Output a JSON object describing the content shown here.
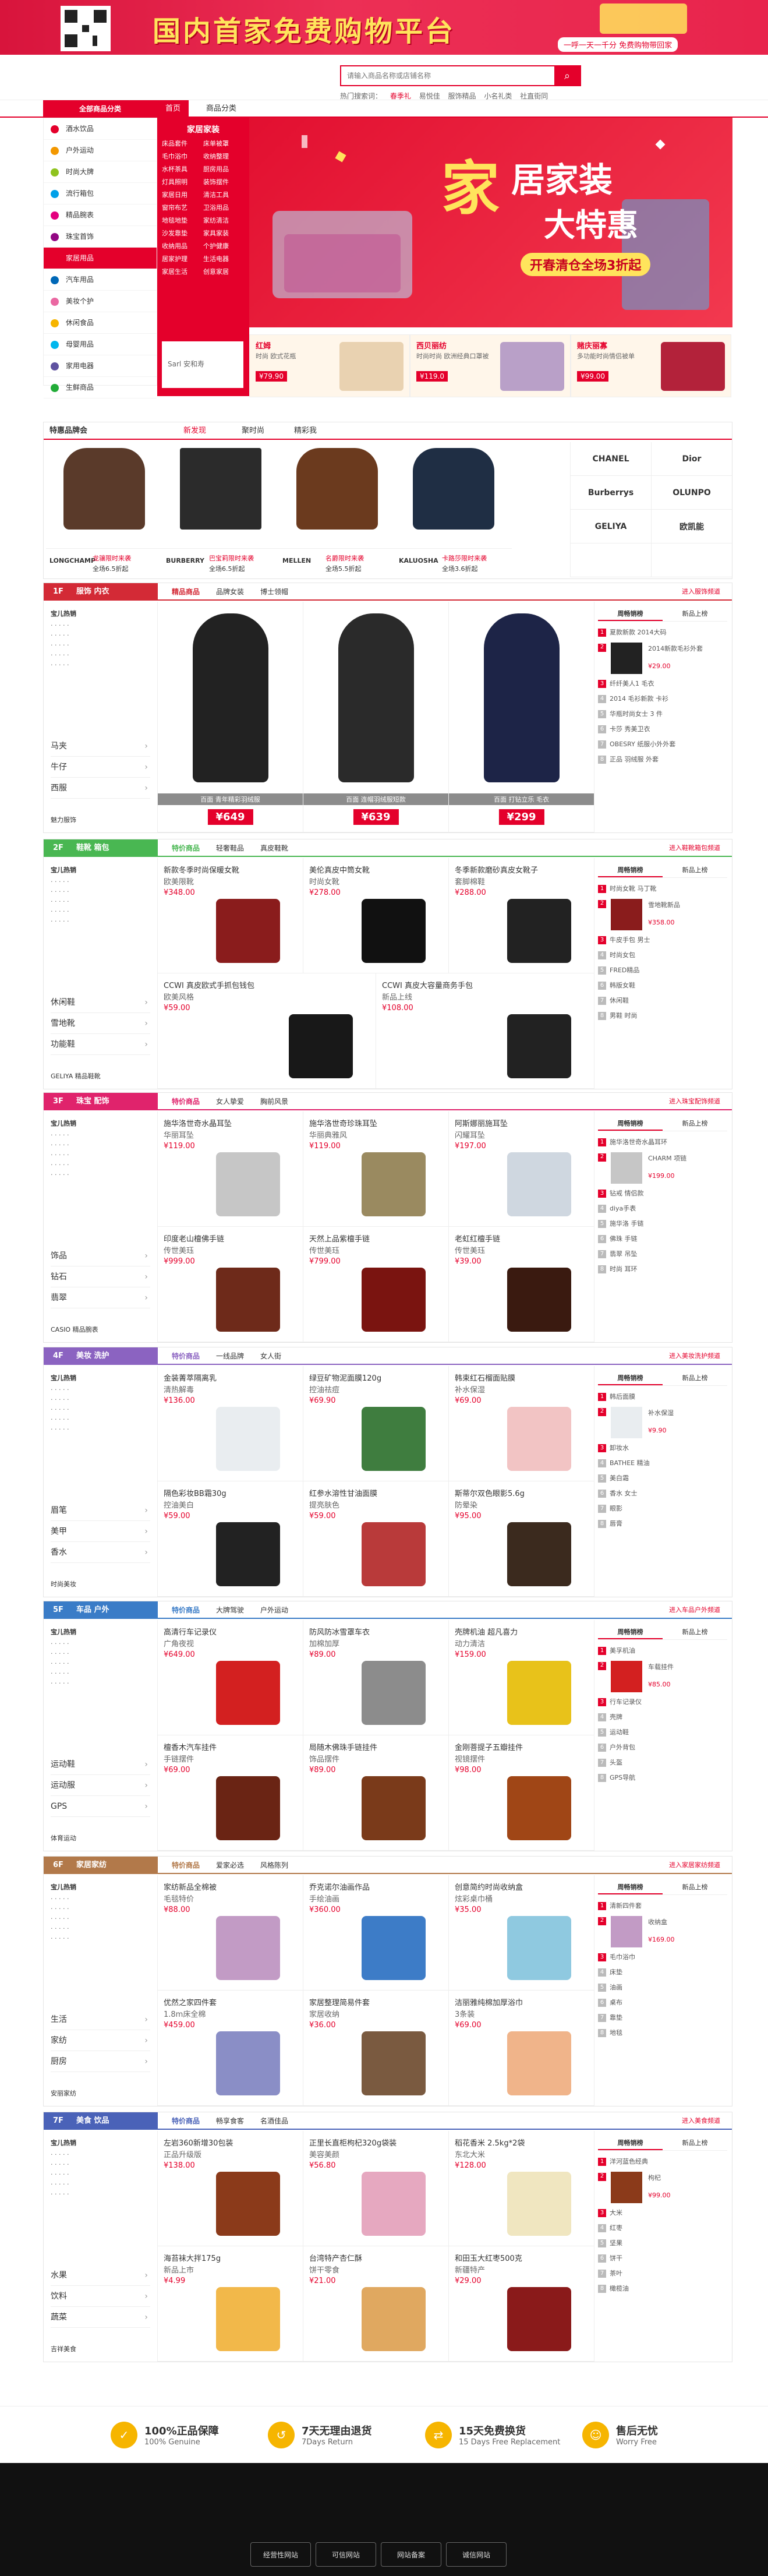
{
  "top": {
    "slogan": "国内首家免费购物平台",
    "sub": "一呼一天一千分 免费购物带回家"
  },
  "search": {
    "placeholder": "请输入商品名称或店铺名称",
    "hot_label": "热门搜索词：",
    "hot": [
      "春季礼",
      "易悦佳",
      "服饰精品",
      "小名礼类",
      "社直街同"
    ]
  },
  "nav": {
    "category": "全部商品分类",
    "tabs": [
      "首页",
      "商品分类"
    ]
  },
  "sidecat": [
    "酒水饮品",
    "户外运动",
    "时尚大牌",
    "流行箱包",
    "精品腕表",
    "珠宝首饰",
    "家居用品",
    "汽车用品",
    "美妆个护",
    "休闲食品",
    "母婴用品",
    "家用电器",
    "生鲜商品"
  ],
  "submenu": {
    "title": "家居家装",
    "items": [
      "床品套件",
      "床单被罩",
      "毛巾浴巾",
      "收纳整理",
      "水杯茶具",
      "厨房用品",
      "灯具照明",
      "装饰摆件",
      "家居日用",
      "清洁工具",
      "窗帘布艺",
      "卫浴用品",
      "地毯地垫",
      "家纺清洁",
      "沙发靠垫",
      "家具家装",
      "收纳用品",
      "个护健康",
      "居家护理",
      "生活电器",
      "家居生活",
      "创意家居"
    ],
    "brand": "Sarl 安和寿"
  },
  "banner": {
    "l1": "家",
    "l2": "居家装",
    "l3": "大特惠",
    "tag": "开春清仓全场3折起"
  },
  "promos": [
    {
      "name": "红姆",
      "desc": "时尚 欧式花瓶",
      "price": "¥79.90"
    },
    {
      "name": "西贝丽纺",
      "desc": "时尚时尚 欧洲经典口罩被",
      "price": "¥119.0"
    },
    {
      "name": "赌庆丽寡",
      "desc": "多功能时尚情侣被单",
      "price": "¥99.00"
    }
  ],
  "brandsec": {
    "tabs": [
      "特惠品牌会",
      "新发现",
      "聚时尚",
      "精彩我"
    ],
    "cards": [
      {
        "logo": "LONGCHAMP",
        "a": "龙骧限时来袭",
        "b": "全场6.5折起"
      },
      {
        "logo": "BURBERRY",
        "a": "巴宝莉限时来袭",
        "b": "全场6.5折起"
      },
      {
        "logo": "MELLEN",
        "a": "名爵限时来袭",
        "b": "全场5.5折起"
      },
      {
        "logo": "KALUOSHA",
        "a": "卡路莎限时来袭",
        "b": "全场3.6折起"
      }
    ],
    "logos": [
      "CHANEL",
      "Dior",
      "Burberrys",
      "OLUNPO",
      "GELIYA",
      "欧凯能"
    ]
  },
  "floors": [
    {
      "no": "1F",
      "name": "服饰 内衣",
      "color": "#d32a36",
      "tabs": [
        "精品商品",
        "品牌女装",
        "博士领帽"
      ],
      "more": "进入服饰频道",
      "hot": "宝儿热销",
      "links": [
        "马夹",
        "牛仔",
        "西服"
      ],
      "logo": "魅力服饰",
      "goods": [
        {
          "caption": "百面 青年精彩羽绒服",
          "price": "¥649"
        },
        {
          "caption": "百面 连帽羽绒服短款",
          "price": "¥639"
        },
        {
          "caption": "百面 打钻立乐 毛衣",
          "price": "¥299"
        }
      ],
      "rank": [
        "夏款新款 2014大码",
        "2014新款毛衫外套",
        "纤纤美人1 毛衣",
        "2014 毛衫新款 卡衫",
        "华瓶时尚女士 3 件",
        "卡莎 秀美卫衣",
        "OBESRY 纸服小外外套",
        "正品 羽绒服 外套"
      ],
      "rankprice": "¥29.00"
    },
    {
      "no": "2F",
      "name": "鞋靴 箱包",
      "color": "#49b752",
      "tabs": [
        "特价商品",
        "轻奢鞋品",
        "真皮鞋靴"
      ],
      "more": "进入鞋靴箱包频道",
      "hot": "宝儿热销",
      "links": [
        "休闲鞋",
        "雪地靴",
        "功能鞋"
      ],
      "logo": "GELIYA 精品鞋靴",
      "goods": [
        {
          "t1": "新款冬季时尚保暖女靴",
          "t2": "欧美限靴",
          "pr": "¥348.00"
        },
        {
          "t1": "美伦真皮中筒女靴",
          "t2": "时尚女靴",
          "pr": "¥278.00"
        },
        {
          "t1": "冬季新款磨砂真皮女靴子",
          "t2": "套脚棉鞋",
          "pr": "¥288.00"
        },
        {
          "t1": "CCWI 真皮欧式手抓包钱包",
          "t2": "欧美风格",
          "pr": "¥59.00"
        },
        {
          "t1": "CCWI 真皮大容量商务手包",
          "t2": "新品上线",
          "pr": "¥108.00"
        }
      ],
      "rank": [
        "时尚女靴 马丁靴",
        "雪地靴新品",
        "牛皮手包 男士",
        "时尚女包",
        "FRED精品",
        "韩版女鞋",
        "休闲鞋",
        "男鞋 时尚"
      ],
      "rankprice": "¥358.00"
    },
    {
      "no": "3F",
      "name": "珠宝 配饰",
      "color": "#e0236c",
      "tabs": [
        "特价商品",
        "女人挚爱",
        "胸前风景"
      ],
      "more": "进入珠宝配饰频道",
      "hot": "宝儿热销",
      "links": [
        "饰品",
        "钻石",
        "翡翠"
      ],
      "logo": "CASIO 精品腕表",
      "goods": [
        {
          "t1": "施华洛世奇水晶耳坠",
          "t2": "华丽耳坠",
          "pr": "¥119.00"
        },
        {
          "t1": "施华洛世奇珍珠耳坠",
          "t2": "华丽典雅风",
          "pr": "¥119.00"
        },
        {
          "t1": "阿斯娜丽施耳坠",
          "t2": "闪耀耳坠",
          "pr": "¥197.00"
        },
        {
          "t1": "印度老山檀佛手链",
          "t2": "传世美珏",
          "pr": "¥999.00"
        },
        {
          "t1": "天然上品紫檀手链",
          "t2": "传世美珏",
          "pr": "¥799.00"
        },
        {
          "t1": "老虹红檀手链",
          "t2": "传世美珏",
          "pr": "¥39.00"
        }
      ],
      "rank": [
        "施华洛世奇水晶耳环",
        "CHARM 项链",
        "钻戒 情侣款",
        "diya手表",
        "施华洛 手链",
        "佛珠 手链",
        "翡翠 吊坠",
        "时尚 耳环"
      ],
      "rankprice": "¥199.00"
    },
    {
      "no": "4F",
      "name": "美妆 洗护",
      "color": "#8b63c1",
      "tabs": [
        "特价商品",
        "一线品牌",
        "女人街"
      ],
      "more": "进入美妆洗护频道",
      "hot": "宝儿热销",
      "links": [
        "眉笔",
        "美甲",
        "香水"
      ],
      "logo": "时尚美妆",
      "goods": [
        {
          "t1": "金装菁萃隔离乳",
          "t2": "清热解毒",
          "pr": "¥136.00"
        },
        {
          "t1": "绿豆矿物泥面膜120g",
          "t2": "控油祛痘",
          "pr": "¥69.90"
        },
        {
          "t1": "韩束红石榴面贴膜",
          "t2": "补水保湿",
          "pr": "¥69.00"
        },
        {
          "t1": "隔色彩妆BB霜30g",
          "t2": "控油美白",
          "pr": "¥59.00"
        },
        {
          "t1": "红参水溶性甘油面膜",
          "t2": "提亮肤色",
          "pr": "¥59.00"
        },
        {
          "t1": "斯蒂尔双色眼影5.6g",
          "t2": "防晕染",
          "pr": "¥95.00"
        }
      ],
      "rank": [
        "韩后面膜",
        "补水保湿",
        "卸妆水",
        "BATHEE 精油",
        "美白霜",
        "香水 女士",
        "眼影",
        "唇膏"
      ],
      "rankprice": "¥9.90"
    },
    {
      "no": "5F",
      "name": "车品 户外",
      "color": "#3a7cc7",
      "tabs": [
        "特价商品",
        "大牌驾驶",
        "户外运动"
      ],
      "more": "进入车品户外频道",
      "hot": "宝儿热销",
      "links": [
        "运动鞋",
        "运动服",
        "GPS"
      ],
      "logo": "体育运动",
      "goods": [
        {
          "t1": "高清行车记录仪",
          "t2": "广角夜视",
          "pr": "¥649.00"
        },
        {
          "t1": "防风防冰雪罩车衣",
          "t2": "加棉加厚",
          "pr": "¥89.00"
        },
        {
          "t1": "壳牌机油 超凡喜力",
          "t2": "动力清洁",
          "pr": "¥159.00"
        },
        {
          "t1": "檀香木汽车挂件",
          "t2": "手链摆件",
          "pr": "¥69.00"
        },
        {
          "t1": "局随木佛珠手链挂件",
          "t2": "饰品摆件",
          "pr": "¥89.00"
        },
        {
          "t1": "金刚菩提子五瓣挂件",
          "t2": "视镜摆件",
          "pr": "¥98.00"
        }
      ],
      "rank": [
        "美孚机油",
        "车载挂件",
        "行车记录仪",
        "壳牌",
        "运动鞋",
        "户外背包",
        "头盔",
        "GPS导航"
      ],
      "rankprice": "¥85.00"
    },
    {
      "no": "6F",
      "name": "家居家纺",
      "color": "#b2794a",
      "tabs": [
        "特价商品",
        "爱家必选",
        "风格陈列"
      ],
      "more": "进入家居家纺频道",
      "hot": "宝儿热销",
      "links": [
        "生活",
        "家纺",
        "厨房"
      ],
      "logo": "安丽家纺",
      "goods": [
        {
          "t1": "家纺新品全棉被",
          "t2": "毛毯特价",
          "pr": "¥88.00"
        },
        {
          "t1": "乔克诺尔油画作品",
          "t2": "手绘油画",
          "pr": "¥360.00"
        },
        {
          "t1": "创意简约时尚收纳盒",
          "t2": "炫彩桌巾桶",
          "pr": "¥35.00"
        },
        {
          "t1": "优然之家四件套",
          "t2": "1.8m床全棉",
          "pr": "¥459.00"
        },
        {
          "t1": "家居整理简易件套",
          "t2": "家居收纳",
          "pr": "¥36.00"
        },
        {
          "t1": "洁丽雅纯棉加厚浴巾",
          "t2": "3条装",
          "pr": "¥69.00"
        }
      ],
      "rank": [
        "清新四件套",
        "收纳盒",
        "毛巾浴巾",
        "床垫",
        "油画",
        "桌布",
        "靠垫",
        "地毯"
      ],
      "rankprice": "¥169.00"
    },
    {
      "no": "7F",
      "name": "美食 饮品",
      "color": "#4a62b8",
      "tabs": [
        "特价商品",
        "畅享食客",
        "名酒佳品"
      ],
      "more": "进入美食频道",
      "hot": "宝儿热销",
      "links": [
        "水果",
        "饮料",
        "蔬菜"
      ],
      "logo": "吉祥美食",
      "goods": [
        {
          "t1": "左岩360新增30包装",
          "t2": "正品升级版",
          "pr": "¥138.00"
        },
        {
          "t1": "正里长直柜枸杞320g袋装",
          "t2": "美容美颜",
          "pr": "¥56.80"
        },
        {
          "t1": "稻花香米 2.5kg*2袋",
          "t2": "东北大米",
          "pr": "¥128.00"
        },
        {
          "t1": "海苔袜大拌175g",
          "t2": "新品上市",
          "pr": "¥4.99"
        },
        {
          "t1": "台湾特产杏仁酥",
          "t2": "饼干零食",
          "pr": "¥21.00"
        },
        {
          "t1": "和田玉大红枣500克",
          "t2": "新疆特产",
          "pr": "¥29.00"
        }
      ],
      "rank": [
        "洋河蓝色经典",
        "枸杞",
        "大米",
        "红枣",
        "坚果",
        "饼干",
        "茶叶",
        "橄榄油"
      ],
      "rankprice": "¥99.00"
    }
  ],
  "guarantees": [
    {
      "a": "100%正品保障",
      "b": "100% Genuine"
    },
    {
      "a": "7天无理由退货",
      "b": "7Days Return"
    },
    {
      "a": "15天免费换货",
      "b": "15 Days Free Replacement"
    },
    {
      "a": "售后无忧",
      "b": "Worry Free"
    }
  ],
  "badges": [
    "经营性网站",
    "可信网站",
    "网站备案",
    "诚信网站"
  ],
  "rank_tabs": [
    "周畅销榜",
    "新品上榜"
  ]
}
